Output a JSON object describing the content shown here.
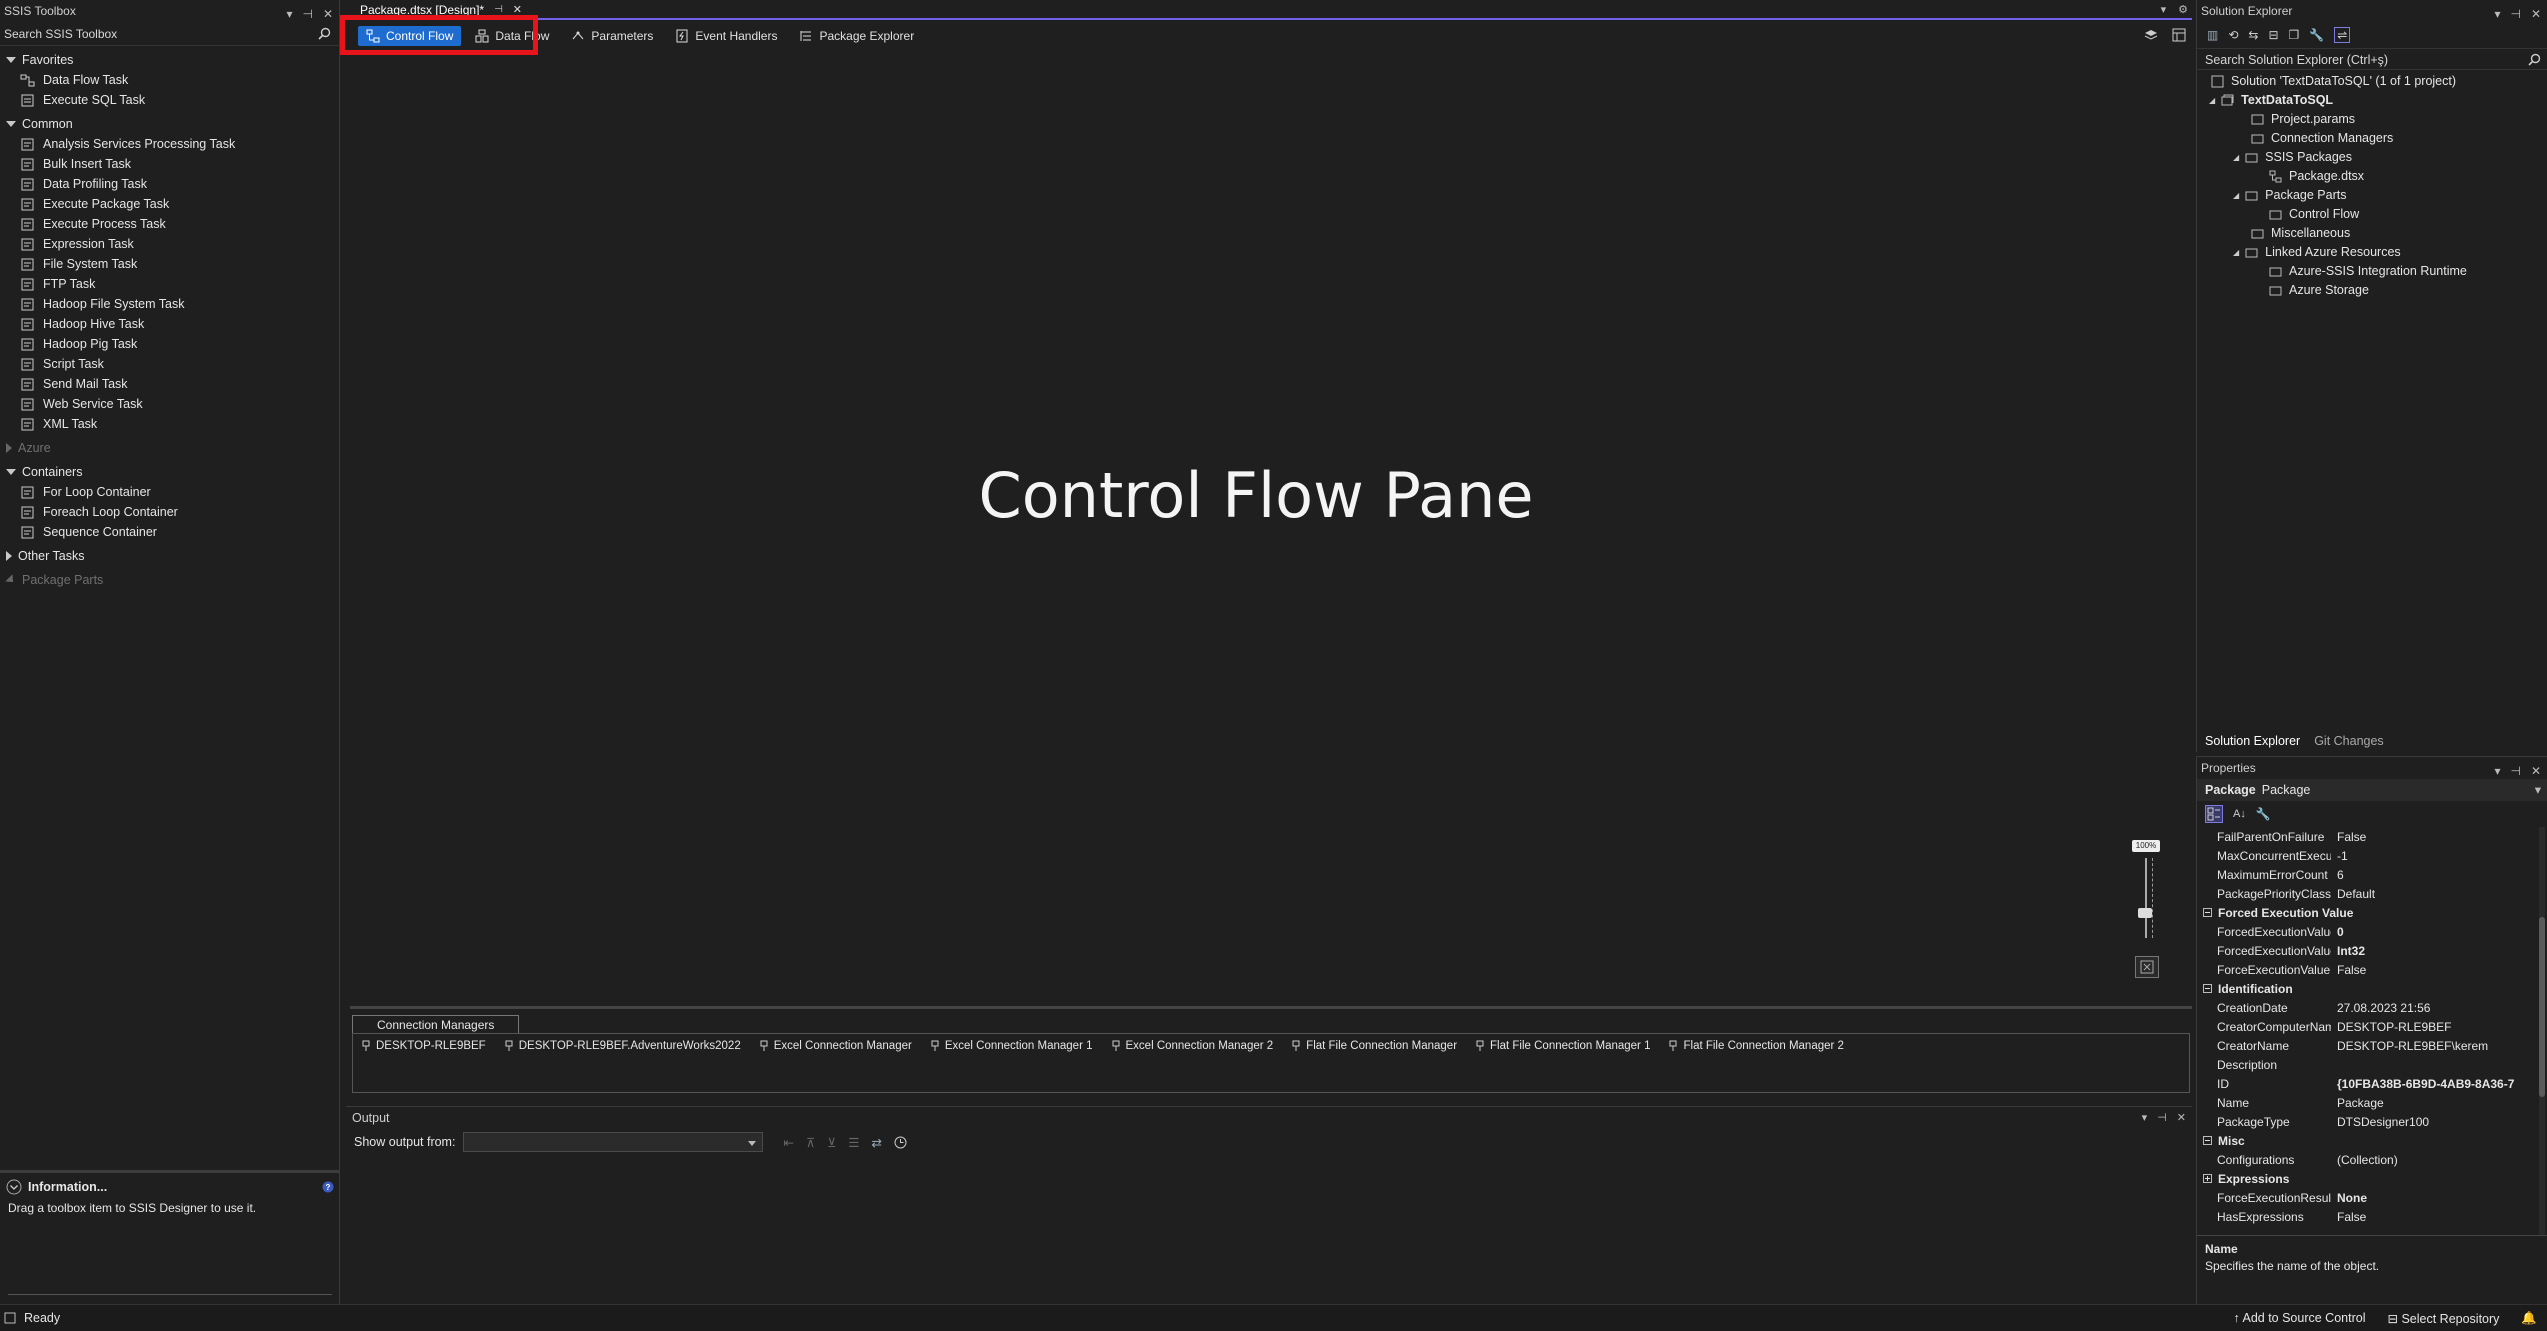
{
  "toolbox": {
    "title": "SSIS Toolbox",
    "search_placeholder": "Search SSIS Toolbox",
    "groups": {
      "favorites": {
        "label": "Favorites",
        "items": [
          "Data Flow Task",
          "Execute SQL Task"
        ]
      },
      "common": {
        "label": "Common",
        "items": [
          "Analysis Services Processing Task",
          "Bulk Insert Task",
          "Data Profiling Task",
          "Execute Package Task",
          "Execute Process Task",
          "Expression Task",
          "File System Task",
          "FTP Task",
          "Hadoop File System Task",
          "Hadoop Hive Task",
          "Hadoop Pig Task",
          "Script Task",
          "Send Mail Task",
          "Web Service Task",
          "XML Task"
        ]
      },
      "azure": {
        "label": "Azure"
      },
      "containers": {
        "label": "Containers",
        "items": [
          "For Loop Container",
          "Foreach Loop Container",
          "Sequence Container"
        ]
      },
      "other": {
        "label": "Other Tasks"
      },
      "package_parts": {
        "label": "Package Parts"
      }
    },
    "info": {
      "title": "Information...",
      "text": "Drag a toolbox item to SSIS Designer to use it."
    }
  },
  "document": {
    "tab_title": "Package.dtsx [Design]*",
    "designer_tabs": [
      "Control Flow",
      "Data Flow",
      "Parameters",
      "Event Handlers",
      "Package Explorer"
    ],
    "canvas_label": "Control Flow Pane",
    "zoom": "100%",
    "connection_managers": {
      "tab": "Connection Managers",
      "items": [
        "DESKTOP-RLE9BEF",
        "DESKTOP-RLE9BEF.AdventureWorks2022",
        "Excel Connection Manager",
        "Excel Connection Manager 1",
        "Excel Connection Manager 2",
        "Flat File Connection Manager",
        "Flat File Connection Manager 1",
        "Flat File Connection Manager 2"
      ]
    },
    "output": {
      "title": "Output",
      "show_from_label": "Show output from:"
    }
  },
  "solution_explorer": {
    "title": "Solution Explorer",
    "search_placeholder": "Search Solution Explorer (Ctrl+ş)",
    "tree": {
      "solution": "Solution 'TextDataToSQL' (1 of 1 project)",
      "project": "TextDataToSQL",
      "project_params": "Project.params",
      "conn_managers": "Connection Managers",
      "ssis_packages": "SSIS Packages",
      "package": "Package.dtsx",
      "package_parts": "Package Parts",
      "control_flow": "Control Flow",
      "misc": "Miscellaneous",
      "linked_azure": "Linked Azure Resources",
      "azure_ir": "Azure-SSIS Integration Runtime",
      "azure_storage": "Azure Storage"
    },
    "bottom_tabs": [
      "Solution Explorer",
      "Git Changes"
    ]
  },
  "properties": {
    "title": "Properties",
    "object_bold": "Package",
    "object_type": "Package",
    "rows": [
      {
        "k": "FailParentOnFailure",
        "v": "False"
      },
      {
        "k": "MaxConcurrentExecutal",
        "v": "-1"
      },
      {
        "k": "MaximumErrorCount",
        "v": "6"
      },
      {
        "k": "PackagePriorityClass",
        "v": "Default"
      }
    ],
    "cat_forced": "Forced Execution Value",
    "forced_rows": [
      {
        "k": "ForcedExecutionValue",
        "v": "0"
      },
      {
        "k": "ForcedExecutionValueTy",
        "v": "Int32"
      },
      {
        "k": "ForceExecutionValue",
        "v": "False"
      }
    ],
    "cat_ident": "Identification",
    "ident_rows": [
      {
        "k": "CreationDate",
        "v": "27.08.2023 21:56"
      },
      {
        "k": "CreatorComputerName",
        "v": "DESKTOP-RLE9BEF"
      },
      {
        "k": "CreatorName",
        "v": "DESKTOP-RLE9BEF\\kerem"
      },
      {
        "k": "Description",
        "v": ""
      },
      {
        "k": "ID",
        "v": "{10FBA38B-6B9D-4AB9-8A36-7"
      },
      {
        "k": "Name",
        "v": "Package"
      },
      {
        "k": "PackageType",
        "v": "DTSDesigner100"
      }
    ],
    "cat_misc": "Misc",
    "misc_rows": [
      {
        "k": "Configurations",
        "v": "(Collection)"
      }
    ],
    "cat_expr": "Expressions",
    "tail_rows": [
      {
        "k": "ForceExecutionResult",
        "v": "None"
      },
      {
        "k": "HasExpressions",
        "v": "False"
      }
    ],
    "desc_name": "Name",
    "desc_text": "Specifies the name of the object."
  },
  "status": {
    "ready": "Ready",
    "add_source": "Add to Source Control",
    "select_repo": "Select Repository"
  },
  "colors": {
    "accent": "#1e6ccf",
    "highlight": "#e8141b",
    "tab_underline": "#7160e8"
  }
}
